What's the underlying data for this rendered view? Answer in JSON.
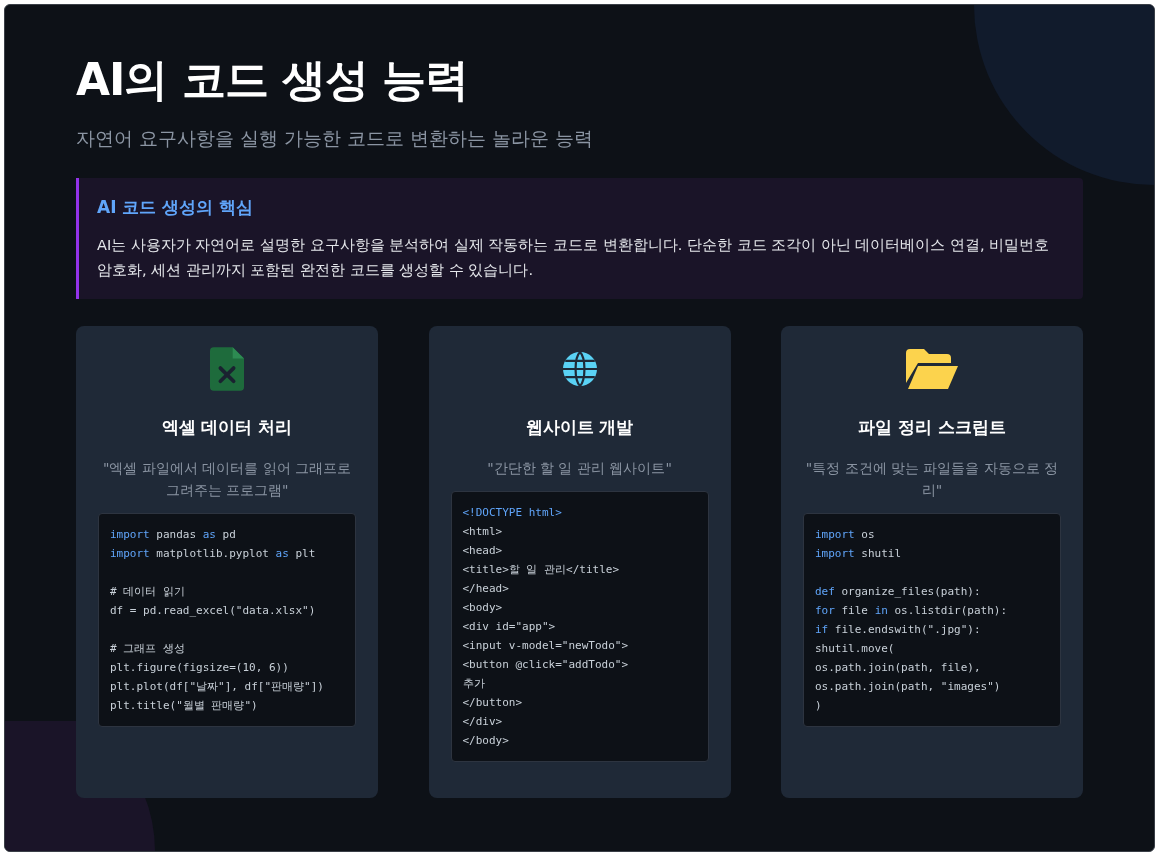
{
  "title": "AI의 코드 생성 능력",
  "subtitle": "자연어 요구사항을 실행 가능한 코드로 변환하는 놀라운 능력",
  "callout": {
    "heading": "AI 코드 생성의 핵심",
    "body": "AI는 사용자가 자연어로 설명한 요구사항을 분석하여 실제 작동하는 코드로 변환합니다. 단순한 코드 조각이 아닌 데이터베이스 연결, 비밀번호 암호화, 세션 관리까지 포함된 완전한 코드를 생성할 수 있습니다."
  },
  "cards": [
    {
      "title": "엑셀 데이터 처리",
      "prompt": "\"엑셀 파일에서 데이터를 읽어 그래프로 그려주는 프로그램\"",
      "code": [
        [
          [
            {
              "t": "import",
              "kw": true
            },
            {
              "t": " pandas ",
              "kw": false
            },
            {
              "t": "as",
              "kw": true
            },
            {
              "t": " pd",
              "kw": false
            }
          ],
          [
            {
              "t": "import",
              "kw": true
            },
            {
              "t": " matplotlib.pyplot ",
              "kw": false
            },
            {
              "t": "as",
              "kw": true
            },
            {
              "t": " plt",
              "kw": false
            }
          ]
        ],
        [
          [
            {
              "t": "# 데이터 읽기",
              "kw": false
            }
          ],
          [
            {
              "t": "df = pd.read_excel(\"data.xlsx\")",
              "kw": false
            }
          ]
        ],
        [
          [
            {
              "t": "# 그래프 생성",
              "kw": false
            }
          ],
          [
            {
              "t": "plt.figure(figsize=(10, 6))",
              "kw": false
            }
          ],
          [
            {
              "t": "plt.plot(df[\"날짜\"], df[\"판매량\"])",
              "kw": false
            }
          ],
          [
            {
              "t": "plt.title(\"월별 판매량\")",
              "kw": false
            }
          ]
        ]
      ]
    },
    {
      "title": "웹사이트 개발",
      "prompt": "\"간단한 할 일 관리 웹사이트\"",
      "code": [
        [
          [
            {
              "t": "<!DOCTYPE html>",
              "kw": true
            }
          ],
          [
            {
              "t": "<html>",
              "kw": false
            }
          ],
          [
            {
              "t": "<head>",
              "kw": false
            }
          ],
          [
            {
              "t": "<title>할 일 관리</title>",
              "kw": false
            }
          ],
          [
            {
              "t": "</head>",
              "kw": false
            }
          ],
          [
            {
              "t": "<body>",
              "kw": false
            }
          ],
          [
            {
              "t": "<div id=\"app\">",
              "kw": false
            }
          ],
          [
            {
              "t": "<input v-model=\"newTodo\">",
              "kw": false
            }
          ],
          [
            {
              "t": "<button @click=\"addTodo\">",
              "kw": false
            }
          ],
          [
            {
              "t": "추가",
              "kw": false
            }
          ],
          [
            {
              "t": "</button>",
              "kw": false
            }
          ],
          [
            {
              "t": "</div>",
              "kw": false
            }
          ],
          [
            {
              "t": "</body>",
              "kw": false
            }
          ]
        ]
      ]
    },
    {
      "title": "파일 정리 스크립트",
      "prompt": "\"특정 조건에 맞는 파일들을 자동으로 정리\"",
      "code": [
        [
          [
            {
              "t": "import",
              "kw": true
            },
            {
              "t": " os",
              "kw": false
            }
          ],
          [
            {
              "t": "import",
              "kw": true
            },
            {
              "t": " shutil",
              "kw": false
            }
          ]
        ],
        [
          [
            {
              "t": "def",
              "kw": true
            },
            {
              "t": " organize_files(path):",
              "kw": false
            }
          ],
          [
            {
              "t": "for",
              "kw": true
            },
            {
              "t": " file ",
              "kw": false
            },
            {
              "t": "in",
              "kw": true
            },
            {
              "t": " os.listdir(path):",
              "kw": false
            }
          ],
          [
            {
              "t": "if",
              "kw": true
            },
            {
              "t": " file.endswith(\".jpg\"):",
              "kw": false
            }
          ],
          [
            {
              "t": "shutil.move(",
              "kw": false
            }
          ],
          [
            {
              "t": "os.path.join(path, file),",
              "kw": false
            }
          ],
          [
            {
              "t": "os.path.join(path, \"images\")",
              "kw": false
            }
          ],
          [
            {
              "t": ")",
              "kw": false
            }
          ]
        ]
      ]
    }
  ]
}
